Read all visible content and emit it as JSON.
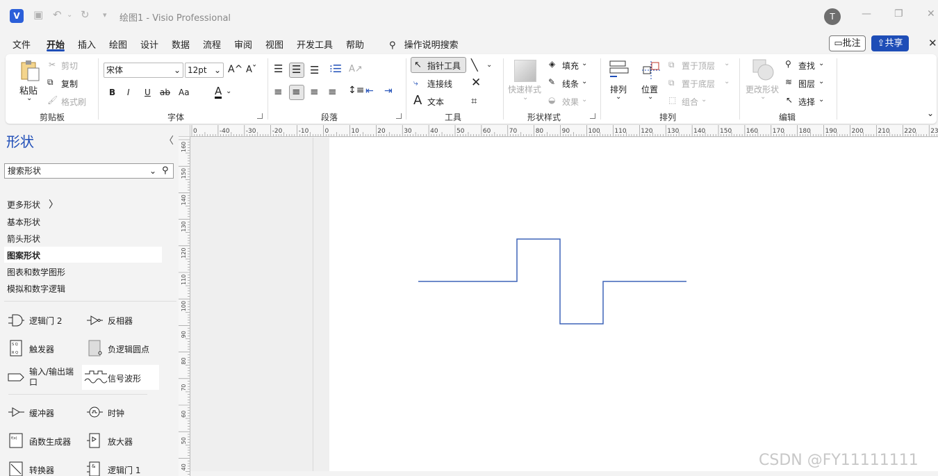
{
  "titlebar": {
    "app_icon": "V",
    "title": "绘图1  -  Visio Professional",
    "user_initial": "T",
    "icons": [
      "save-icon",
      "undo-icon",
      "redo-icon",
      "customize-icon",
      "minimize-icon",
      "restore-icon",
      "close-icon"
    ]
  },
  "menu": {
    "items": [
      "文件",
      "开始",
      "插入",
      "绘图",
      "设计",
      "数据",
      "流程",
      "审阅",
      "视图",
      "开发工具",
      "帮助"
    ],
    "active": "开始",
    "tell_me": "操作说明搜索",
    "comment": "批注",
    "share": "共享"
  },
  "ribbon": {
    "clipboard": {
      "paste": "粘贴",
      "cut": "剪切",
      "copy": "复制",
      "format_painter": "格式刷",
      "label": "剪贴板"
    },
    "font": {
      "family": "宋体",
      "size": "12pt",
      "label": "字体",
      "bold": "B",
      "italic": "I",
      "underline": "U",
      "strike": "ab",
      "case": "Aa",
      "color": "A"
    },
    "paragraph": {
      "label": "段落"
    },
    "tools": {
      "pointer": "指针工具",
      "connector": "连接线",
      "text": "文本",
      "label": "工具"
    },
    "shape_styles": {
      "quick": "快速样式",
      "fill": "填充",
      "line": "线条",
      "effects": "效果",
      "label": "形状样式"
    },
    "arrange": {
      "arrange": "排列",
      "position": "位置",
      "bring_front": "置于顶层",
      "send_back": "置于底层",
      "group": "组合",
      "label": "排列"
    },
    "editing": {
      "change_shape": "更改形状",
      "find": "查找",
      "layers": "图层",
      "select": "选择",
      "label": "编辑"
    }
  },
  "shapes_pane": {
    "title": "形状",
    "search_placeholder": "搜索形状",
    "stencils": [
      "更多形状",
      "基本形状",
      "箭头形状",
      "图案形状",
      "图表和数学图形",
      "模拟和数字逻辑"
    ],
    "active_stencil": "图案形状",
    "shapes": [
      "逻辑门 2",
      "反相器",
      "触发器",
      "负逻辑圆点",
      "输入/输出端口",
      "信号波形",
      "缓冲器",
      "时钟",
      "函数生成器",
      "放大器",
      "转换器",
      "逻辑门 1"
    ],
    "selected_shape": "信号波形"
  },
  "ruler": {
    "h_ticks": [
      "0",
      "-40",
      "-30",
      "-20",
      "-10",
      "0",
      "10",
      "20",
      "30",
      "40",
      "50",
      "60",
      "70",
      "80",
      "90",
      "100",
      "110",
      "120",
      "130",
      "140",
      "150",
      "160",
      "170",
      "180",
      "190",
      "200",
      "210",
      "220",
      "230"
    ],
    "v_ticks": [
      "160",
      "150",
      "140",
      "130",
      "120",
      "110",
      "100",
      "90",
      "80",
      "70",
      "60",
      "50",
      "40"
    ]
  },
  "colors": {
    "accent": "#1e4db7",
    "waveform": "#3d63b8"
  },
  "watermark": "CSDN @FY11111111"
}
